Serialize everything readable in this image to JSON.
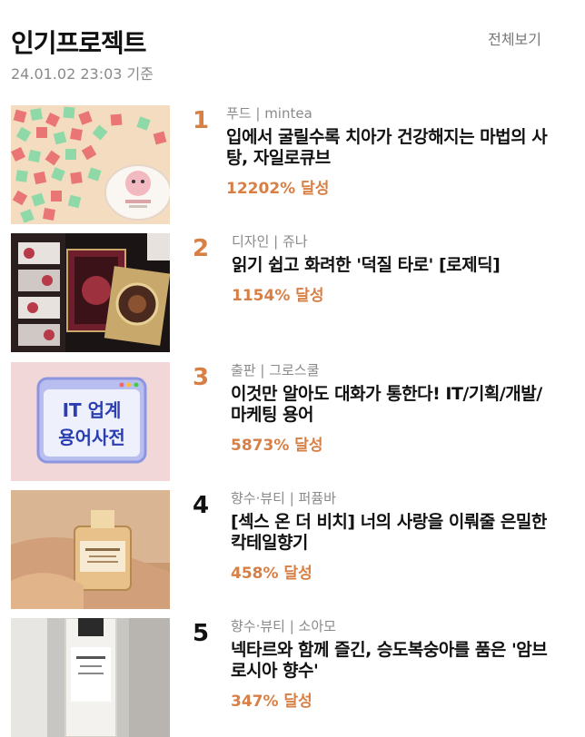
{
  "header": {
    "title": "인기프로젝트",
    "view_all": "전체보기",
    "timestamp": "24.01.02 23:03 기준"
  },
  "items": [
    {
      "rank": "1",
      "category": "푸드 | mintea",
      "title": "입에서 굴릴수록 치아가 건강해지는 마법의 사탕, 자일로큐브",
      "achieve": "12202% 달성",
      "thumbnail_icon": "mint-candy-image"
    },
    {
      "rank": "2",
      "category": "디자인 | 쥬나",
      "title": "읽기 쉽고 화려한 '덕질 타로' [로제딕]",
      "achieve": "1154% 달성",
      "thumbnail_icon": "tarot-card-image"
    },
    {
      "rank": "3",
      "category": "출판 | 그로스쿨",
      "title": "이것만 알아도 대화가 통한다! IT/기획/개발/마케팅 용어",
      "achieve": "5873% 달성",
      "thumbnail_icon": "it-dictionary-image",
      "thumbnail_text_line1": "IT 업계",
      "thumbnail_text_line2": "용어사전"
    },
    {
      "rank": "4",
      "category": "향수·뷰티 | 퍼퓸바",
      "title": "[섹스 온 더 비치] 너의 사랑을 이뤄줄 은밀한 칵테일향기",
      "achieve": "458% 달성",
      "thumbnail_icon": "perfume-bottle-image"
    },
    {
      "rank": "5",
      "category": "향수·뷰티 | 소아모",
      "title": "넥타르와 함께 즐긴, 승도복숭아를 품은 '암브로시아 향수'",
      "achieve": "347% 달성",
      "thumbnail_icon": "ambrosia-perfume-image"
    }
  ],
  "colors": {
    "accent": "#d77f45",
    "muted": "#8a8a8a",
    "text": "#111111"
  }
}
